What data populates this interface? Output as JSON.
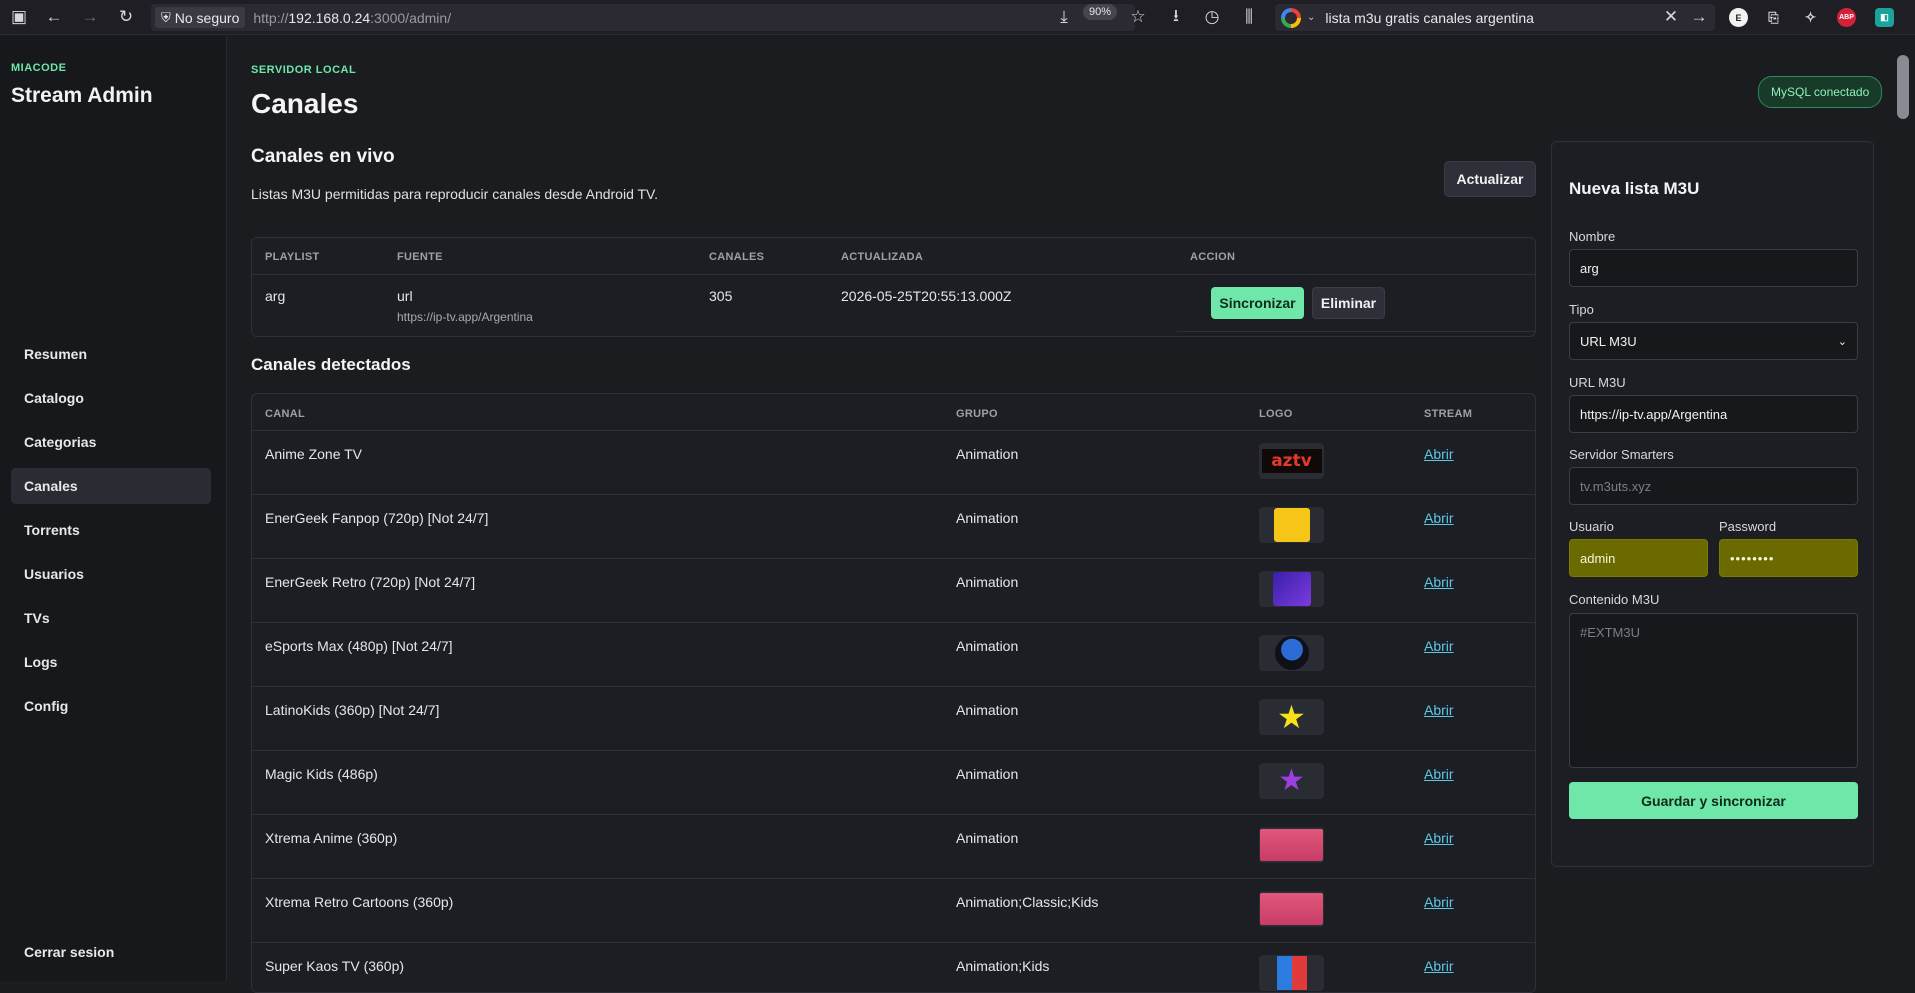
{
  "browser": {
    "security": "No seguro",
    "url_prefix": "http://",
    "url_host": "192.168.0.24",
    "url_rest": ":3000/admin/",
    "zoom": "90%",
    "search_text": "lista m3u gratis canales argentina",
    "ext_e": "E",
    "ext_abp": "ABP"
  },
  "sidebar": {
    "brand_small": "MIACODE",
    "brand_title": "Stream Admin",
    "items": [
      {
        "label": "Resumen"
      },
      {
        "label": "Catalogo"
      },
      {
        "label": "Categorias"
      },
      {
        "label": "Canales"
      },
      {
        "label": "Torrents"
      },
      {
        "label": "Usuarios"
      },
      {
        "label": "TVs"
      },
      {
        "label": "Logs"
      },
      {
        "label": "Config"
      }
    ],
    "logout": "Cerrar sesion"
  },
  "header": {
    "eyebrow": "SERVIDOR LOCAL",
    "title": "Canales",
    "status_badge": "MySQL conectado"
  },
  "live": {
    "title": "Canales en vivo",
    "subtitle": "Listas M3U permitidas para reproducir canales desde Android TV.",
    "refresh": "Actualizar",
    "columns": [
      "PLAYLIST",
      "FUENTE",
      "CANALES",
      "ACTUALIZADA",
      "ACCION"
    ],
    "row": {
      "playlist": "arg",
      "source": "url",
      "source_url": "https://ip-tv.app/Argentina",
      "channels": "305",
      "updated": "2026-05-25T20:55:13.000Z",
      "sync": "Sincronizar",
      "delete": "Eliminar"
    }
  },
  "detected": {
    "title": "Canales detectados",
    "columns": [
      "CANAL",
      "GRUPO",
      "LOGO",
      "STREAM"
    ],
    "rows": [
      {
        "name": "Anime Zone TV",
        "group": "Animation",
        "link": "Abrir",
        "logo": "aztv"
      },
      {
        "name": "EnerGeek Fanpop (720p) [Not 24/7]",
        "group": "Animation",
        "link": "Abrir",
        "logo": "fanpop"
      },
      {
        "name": "EnerGeek Retro (720p) [Not 24/7]",
        "group": "Animation",
        "link": "Abrir",
        "logo": "retro"
      },
      {
        "name": "eSports Max (480p) [Not 24/7]",
        "group": "Animation",
        "link": "Abrir",
        "logo": "esports"
      },
      {
        "name": "LatinoKids (360p) [Not 24/7]",
        "group": "Animation",
        "link": "Abrir",
        "logo": "star"
      },
      {
        "name": "Magic Kids (486p)",
        "group": "Animation",
        "link": "Abrir",
        "logo": "magic"
      },
      {
        "name": "Xtrema Anime (360p)",
        "group": "Animation",
        "link": "Abrir",
        "logo": "xtrema"
      },
      {
        "name": "Xtrema Retro Cartoons (360p)",
        "group": "Animation;Classic;Kids",
        "link": "Abrir",
        "logo": "xtrema"
      },
      {
        "name": "Super Kaos TV (360p)",
        "group": "Animation;Kids",
        "link": "Abrir",
        "logo": "kaos"
      }
    ]
  },
  "form": {
    "title": "Nueva lista M3U",
    "name_label": "Nombre",
    "name_value": "arg",
    "type_label": "Tipo",
    "type_value": "URL M3U",
    "url_label": "URL M3U",
    "url_value": "https://ip-tv.app/Argentina",
    "server_label": "Servidor Smarters",
    "server_placeholder": "tv.m3uts.xyz",
    "user_label": "Usuario",
    "user_value": "admin",
    "pass_label": "Password",
    "pass_value": "••••••••",
    "content_label": "Contenido M3U",
    "content_placeholder": "#EXTM3U",
    "save": "Guardar y sincronizar"
  },
  "colors": {
    "accent": "#6ee7a8",
    "link": "#5cc8e8",
    "autofill": "#6b6a00"
  }
}
